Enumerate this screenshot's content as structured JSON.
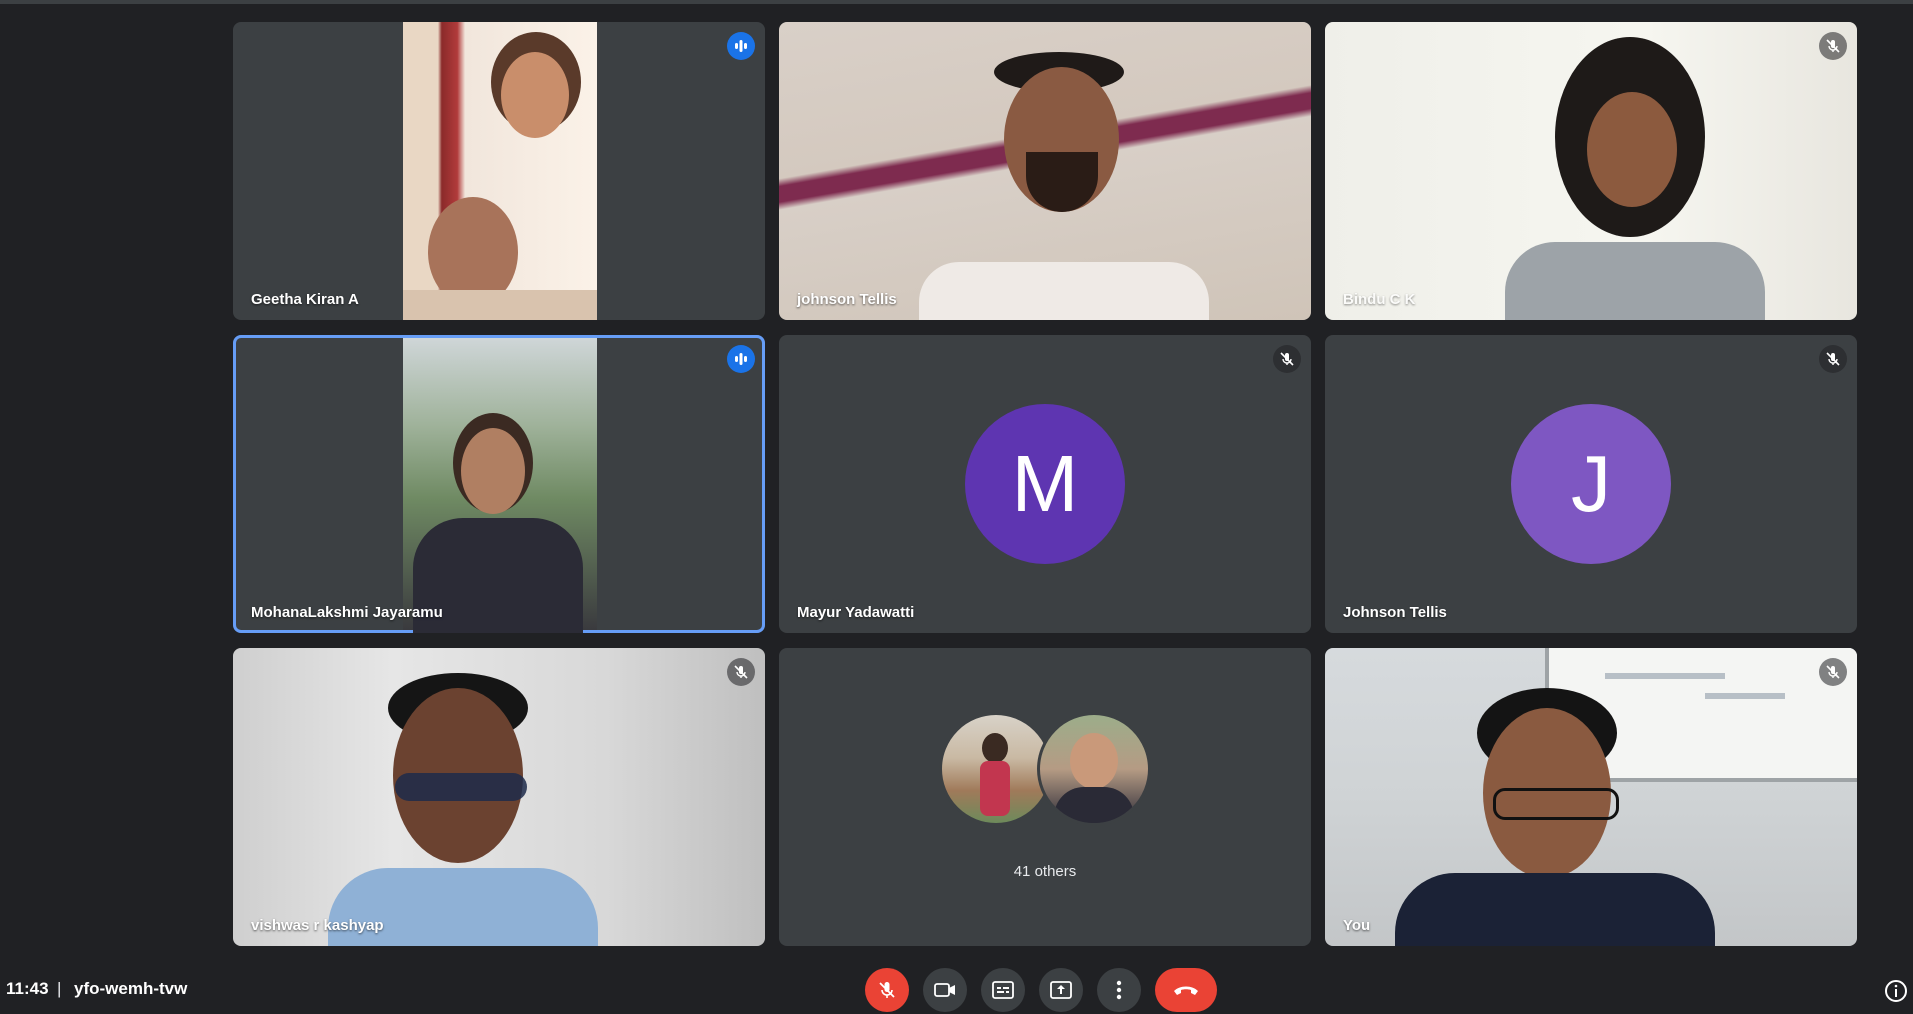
{
  "meeting": {
    "time": "11:43",
    "separator": "|",
    "code": "yfo-wemh-tvw",
    "others_label": "41 others"
  },
  "participants": [
    {
      "name": "Geetha Kiran A",
      "status": "speaking"
    },
    {
      "name": "johnson Tellis",
      "status": "none"
    },
    {
      "name": "Bindu C K",
      "status": "muted"
    },
    {
      "name": "MohanaLakshmi Jayaramu",
      "status": "speaking"
    },
    {
      "name": "Mayur Yadawatti",
      "status": "muted",
      "avatar_letter": "M",
      "avatar_color": "#5e35b1"
    },
    {
      "name": "Johnson Tellis",
      "status": "muted",
      "avatar_letter": "J",
      "avatar_color": "#7e57c2"
    },
    {
      "name": "vishwas r kashyap",
      "status": "muted"
    },
    {
      "name": "You",
      "status": "muted"
    }
  ],
  "controls": [
    {
      "name": "microphone-off-button",
      "icon": "mic-off-icon",
      "color": "#ea4335"
    },
    {
      "name": "camera-button",
      "icon": "videocam-icon"
    },
    {
      "name": "captions-button",
      "icon": "closed-captions-icon"
    },
    {
      "name": "present-button",
      "icon": "present-screen-icon"
    },
    {
      "name": "more-options-button",
      "icon": "more-vert-icon"
    },
    {
      "name": "leave-call-button",
      "icon": "call-end-icon",
      "color": "#ea4335"
    }
  ],
  "colors": {
    "background": "#202124",
    "tile": "#3c4043",
    "active_border": "#669df6",
    "speaking": "#1a73e8",
    "danger": "#ea4335"
  }
}
